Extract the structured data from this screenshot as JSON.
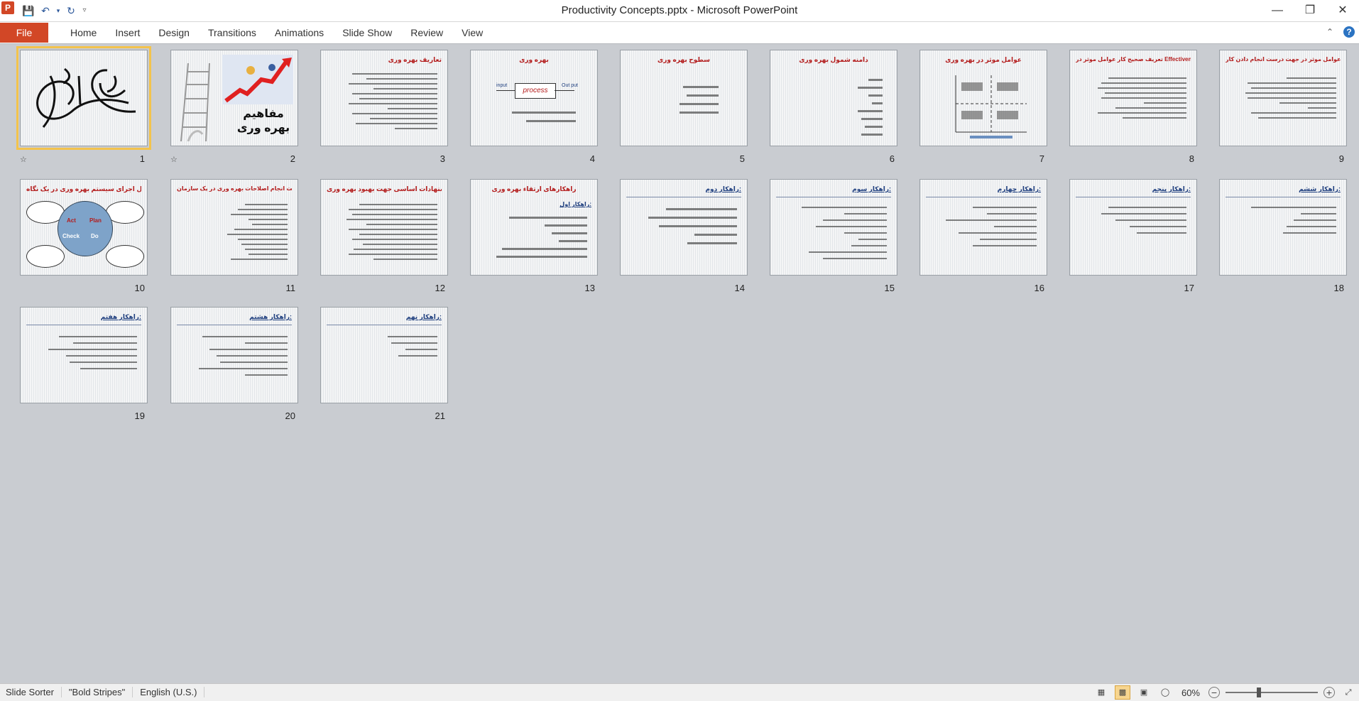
{
  "window": {
    "title": "Productivity Concepts.pptx - Microsoft PowerPoint"
  },
  "qat": {
    "save_icon": "save-icon",
    "undo_icon": "undo-icon",
    "redo_icon": "repeat-icon"
  },
  "ribbon": {
    "file": "File",
    "tabs": [
      "Home",
      "Insert",
      "Design",
      "Transitions",
      "Animations",
      "Slide Show",
      "Review",
      "View"
    ]
  },
  "slides": [
    {
      "n": "1",
      "title": ""
    },
    {
      "n": "2",
      "title": "مفاهیم بهره وری"
    },
    {
      "n": "3",
      "title": "تعاریف بهره وری"
    },
    {
      "n": "4",
      "title": "بهره وری",
      "input": "input",
      "process": "process",
      "output": "Out put"
    },
    {
      "n": "5",
      "title": "سطوح بهره وری"
    },
    {
      "n": "6",
      "title": "دامنه شمول بهره وری"
    },
    {
      "n": "7",
      "title": "عوامل موثر در بهره وری"
    },
    {
      "n": "8",
      "title": "تعریف صحیح کار عوامل موثر در Effectiveness"
    },
    {
      "n": "9",
      "title": "عوامل موثر در جهت درست انجام دادن کار Efficiency"
    },
    {
      "n": "10",
      "title": "مراحل اجرای سیستم بهره وری در یک نگاه",
      "act": "Act",
      "plan": "Plan",
      "check": "Check",
      "do": "Do"
    },
    {
      "n": "11",
      "title": "راهکارهای لازم جهت انجام اصلاحات بهره وری در یک سازمان"
    },
    {
      "n": "12",
      "title": "پیشنهادات اساسی جهت بهبود بهره وری"
    },
    {
      "n": "13",
      "title": "راهکارهای ارتقاء بهره وری",
      "sub": "راهکار اول:"
    },
    {
      "n": "14",
      "title": "راهکار دوم:"
    },
    {
      "n": "15",
      "title": "راهکار سوم:"
    },
    {
      "n": "16",
      "title": "راهکار چهارم:"
    },
    {
      "n": "17",
      "title": "راهکار پنجم:"
    },
    {
      "n": "18",
      "title": "راهکار ششم:"
    },
    {
      "n": "19",
      "title": "راهکار هفتم:"
    },
    {
      "n": "20",
      "title": "راهکار هشتم:"
    },
    {
      "n": "21",
      "title": "راهکار نهم:"
    }
  ],
  "status": {
    "view": "Slide Sorter",
    "theme": "\"Bold Stripes\"",
    "language": "English (U.S.)",
    "zoom": "60%",
    "zoom_minus": "−",
    "zoom_plus": "+"
  }
}
